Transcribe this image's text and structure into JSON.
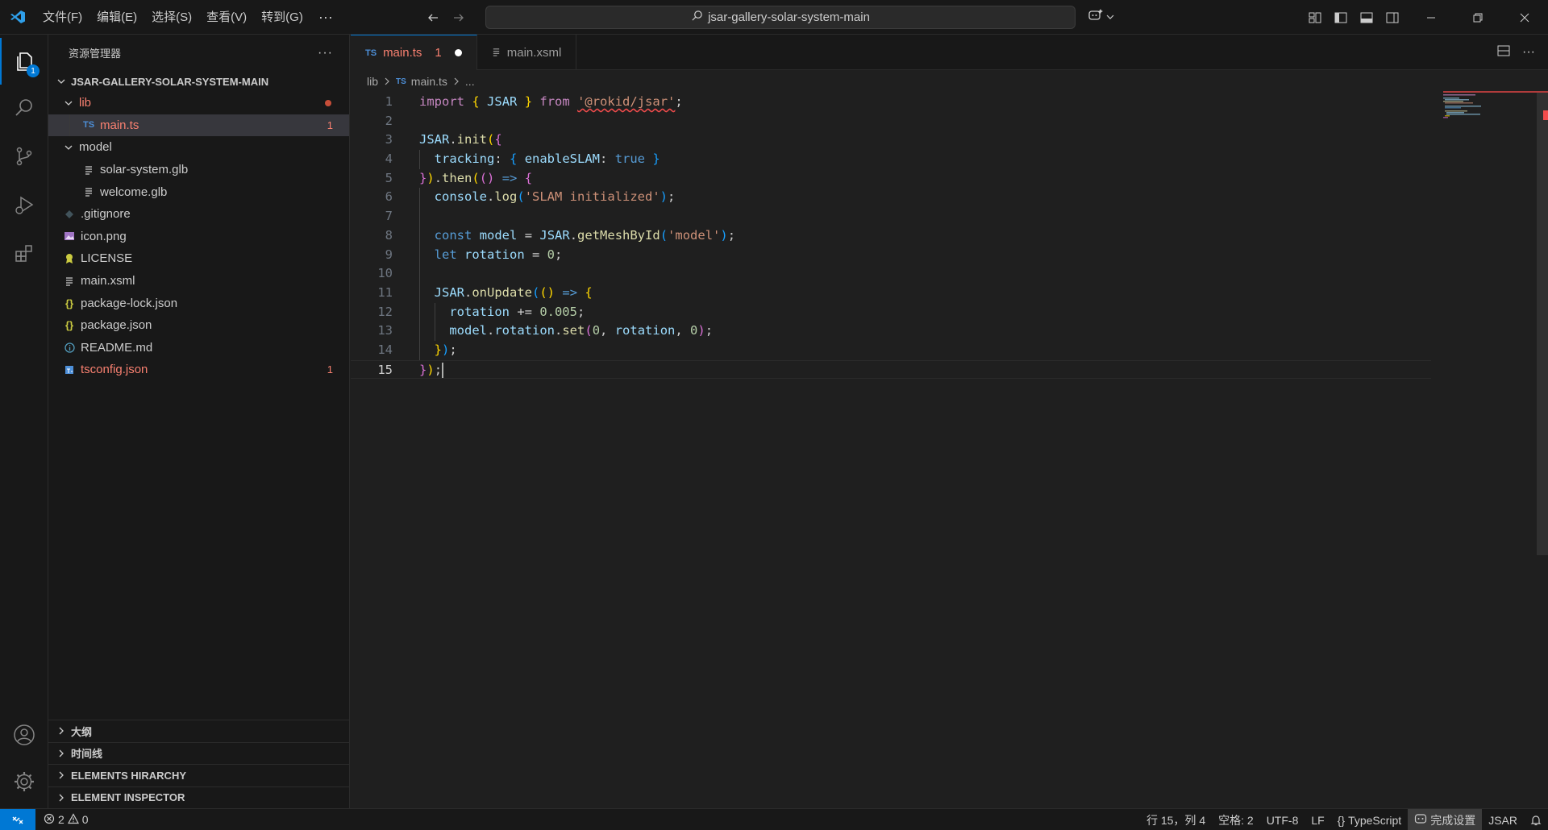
{
  "menu": [
    "文件(F)",
    "编辑(E)",
    "选择(S)",
    "查看(V)",
    "转到(G)"
  ],
  "menu_more": "···",
  "search": {
    "text": "jsar-gallery-solar-system-main"
  },
  "activity": {
    "explorer_badge": "1"
  },
  "sidebar": {
    "title": "资源管理器",
    "more": "···",
    "folder": "JSAR-GALLERY-SOLAR-SYSTEM-MAIN",
    "tree": [
      {
        "label": "lib",
        "icon": "folder-open-chevron",
        "problems": ""
      },
      {
        "label": "main.ts",
        "icon": "TS",
        "problems": "1"
      },
      {
        "label": "model",
        "icon": "folder-open-chevron",
        "problems": ""
      },
      {
        "label": "solar-system.glb",
        "icon": "file-lines-icon",
        "problems": ""
      },
      {
        "label": "welcome.glb",
        "icon": "file-lines-icon",
        "problems": ""
      },
      {
        "label": ".gitignore",
        "icon": "gitignore-icon",
        "problems": ""
      },
      {
        "label": "icon.png",
        "icon": "image-icon",
        "problems": ""
      },
      {
        "label": "LICENSE",
        "icon": "license-icon",
        "problems": ""
      },
      {
        "label": "main.xsml",
        "icon": "file-lines-icon",
        "problems": ""
      },
      {
        "label": "package-lock.json",
        "icon": "json-icon",
        "problems": ""
      },
      {
        "label": "package.json",
        "icon": "json-icon",
        "problems": ""
      },
      {
        "label": "README.md",
        "icon": "info-icon",
        "problems": ""
      },
      {
        "label": "tsconfig.json",
        "icon": "tsconfig-icon",
        "problems": "1"
      }
    ],
    "sections": [
      "大纲",
      "时间线",
      "ELEMENTS HIRARCHY",
      "ELEMENT INSPECTOR"
    ]
  },
  "tabs": [
    {
      "badge": "TS",
      "label": "main.ts",
      "problems": "1",
      "active": true,
      "modified": true
    },
    {
      "badge": "",
      "label": "main.xsml",
      "problems": "",
      "active": false,
      "modified": false
    }
  ],
  "breadcrumb": {
    "folder": "lib",
    "badge": "TS",
    "file": "main.ts",
    "more": "..."
  },
  "editor": {
    "line_numbers": [
      "1",
      "2",
      "3",
      "4",
      "5",
      "6",
      "7",
      "8",
      "9",
      "10",
      "11",
      "12",
      "13",
      "14",
      "15"
    ],
    "current_line": 15
  },
  "status": {
    "errors": "2",
    "warnings": "0",
    "position": "行 15，列 4",
    "spaces": "空格: 2",
    "encoding": "UTF-8",
    "eol": "LF",
    "language": "TypeScript",
    "copilot": "完成设置",
    "extension": "JSAR"
  }
}
